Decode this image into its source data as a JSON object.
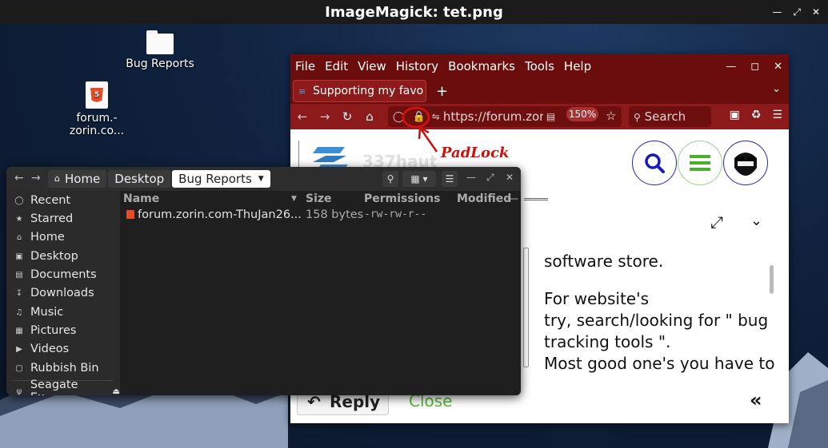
{
  "window_title": "ImageMagick: tet.png",
  "desktop": {
    "icons": [
      {
        "label": "Bug Reports",
        "type": "folder"
      },
      {
        "label": "forum.-zorin.co...",
        "type": "html-file"
      }
    ]
  },
  "firefox": {
    "menu": [
      "File",
      "Edit",
      "View",
      "History",
      "Bookmarks",
      "Tools",
      "Help"
    ],
    "tab_title": "Supporting my favo",
    "url": "https://forum.zorin",
    "zoom": "150%",
    "search_placeholder": "Search",
    "site_name": "337haut",
    "post_lines": [
      "software store.",
      "For website's",
      "try, search/looking for \" bug",
      "tracking tools \".",
      "Most good one's you have to"
    ],
    "reply_label": "Reply",
    "close_label": "Close"
  },
  "annotation": {
    "label": "PadLock",
    "color": "#cc1111"
  },
  "files": {
    "breadcrumbs": [
      "Home",
      "Desktop",
      "Bug Reports"
    ],
    "sidebar": [
      "Recent",
      "Starred",
      "Home",
      "Desktop",
      "Documents",
      "Downloads",
      "Music",
      "Pictures",
      "Videos",
      "Rubbish Bin",
      "Seagate Ex..."
    ],
    "columns": [
      "Name",
      "Size",
      "Permissions",
      "Modified"
    ],
    "rows": [
      {
        "name": "forum.zorin.com-ThuJan26...",
        "size": "158 bytes",
        "permissions": "-rw-rw-r--"
      }
    ]
  }
}
